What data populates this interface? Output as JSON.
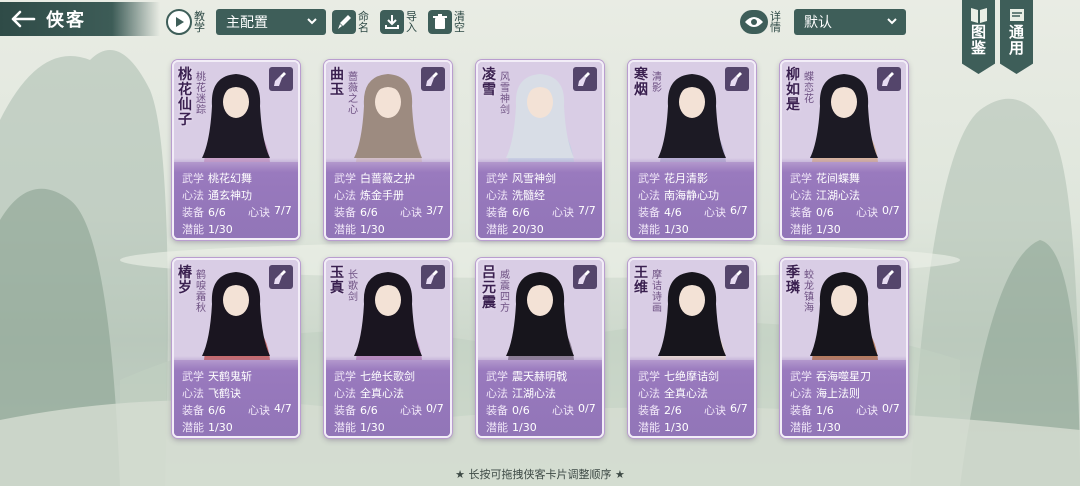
{
  "header": {
    "title": "侠客",
    "tutorial_label": "教学",
    "preset_select": "主配置",
    "rename_label": "命名",
    "import_label": "导入",
    "clear_label": "清空",
    "detail_label": "详情",
    "sort_select": "默认",
    "side_tabs": [
      {
        "c1": "图",
        "c2": "鉴"
      },
      {
        "c1": "通",
        "c2": "用"
      }
    ]
  },
  "labels": {
    "martial": "武学",
    "method": "心法",
    "equip": "装备",
    "secret": "心诀",
    "potential": "潜能"
  },
  "cards": [
    {
      "name": "桃花仙子",
      "title": "桃花迷踪",
      "martial": "桃花幻舞",
      "method": "通玄神功",
      "equip": "6/6",
      "secret": "7/7",
      "potential": "1/30",
      "theme": "#caa2c9",
      "hair": "#1e1a26"
    },
    {
      "name": "曲玉",
      "title": "蔷薇之心",
      "martial": "白蔷薇之护",
      "method": "炼金手册",
      "equip": "6/6",
      "secret": "3/7",
      "potential": "1/30",
      "theme": "#d4c0c8",
      "hair": "#9d8b80"
    },
    {
      "name": "凌雪",
      "title": "风雪神剑",
      "martial": "风雪神剑",
      "method": "洗髓经",
      "equip": "6/6",
      "secret": "7/7",
      "potential": "20/30",
      "theme": "#c9d0e4",
      "hair": "#d8dde6"
    },
    {
      "name": "寒烟",
      "title": "清影",
      "martial": "花月清影",
      "method": "南海静心功",
      "equip": "4/6",
      "secret": "6/7",
      "potential": "1/30",
      "theme": "#b8b0d4",
      "hair": "#1c1a24"
    },
    {
      "name": "柳如是",
      "title": "蝶恋花",
      "martial": "花间蝶舞",
      "method": "江湖心法",
      "equip": "0/6",
      "secret": "0/7",
      "potential": "1/30",
      "theme": "#d7b49e",
      "hair": "#1c1a24"
    },
    {
      "name": "椿岁",
      "title": "鹤唳霜秋",
      "martial": "天鹤鬼斩",
      "method": "飞鹤诀",
      "equip": "6/6",
      "secret": "4/7",
      "potential": "1/30",
      "theme": "#c66a6a",
      "hair": "#1a1520"
    },
    {
      "name": "玉真",
      "title": "长歌剑",
      "martial": "七绝长歌剑",
      "method": "全真心法",
      "equip": "6/6",
      "secret": "0/7",
      "potential": "1/30",
      "theme": "#b98dbf",
      "hair": "#1a1520"
    },
    {
      "name": "吕元震",
      "title": "威震四方",
      "martial": "震天赫明戟",
      "method": "江湖心法",
      "equip": "0/6",
      "secret": "0/7",
      "potential": "1/30",
      "theme": "#8a7d92",
      "hair": "#17151c"
    },
    {
      "name": "王维",
      "title": "摩诘诗画",
      "martial": "七绝摩诘剑",
      "method": "全真心法",
      "equip": "2/6",
      "secret": "6/7",
      "potential": "1/30",
      "theme": "#e6d6d2",
      "hair": "#17151c"
    },
    {
      "name": "季璘",
      "title": "蛟龙镇海",
      "martial": "吞海噬星刀",
      "method": "海上法则",
      "equip": "1/6",
      "secret": "0/7",
      "potential": "1/30",
      "theme": "#b57a5a",
      "hair": "#17151c"
    }
  ],
  "footer": {
    "hint": "长按可拖拽侠客卡片调整顺序"
  },
  "colors": {
    "accent": "#3e5e59",
    "card": "#bfa6d4",
    "card_dark": "#9276b8"
  }
}
